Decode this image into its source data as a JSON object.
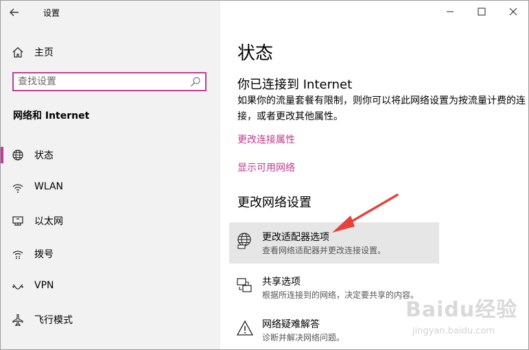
{
  "window": {
    "title": "设置",
    "minimize": "—",
    "maximize": "☐",
    "close": "✕"
  },
  "sidebar": {
    "home_label": "主页",
    "search": {
      "placeholder": "查找设置"
    },
    "section_title": "网络和 Internet",
    "items": [
      {
        "label": "状态",
        "icon": "globe-icon",
        "selected": true
      },
      {
        "label": "WLAN",
        "icon": "wifi-icon",
        "selected": false
      },
      {
        "label": "以太网",
        "icon": "ethernet-icon",
        "selected": false
      },
      {
        "label": "拨号",
        "icon": "dialup-icon",
        "selected": false
      },
      {
        "label": "VPN",
        "icon": "vpn-icon",
        "selected": false
      },
      {
        "label": "飞行模式",
        "icon": "airplane-icon",
        "selected": false
      }
    ]
  },
  "main": {
    "page_title": "状态",
    "status_heading": "你已连接到 Internet",
    "status_desc": "如果你的流量套餐有限制，则你可以将此网络设置为按流量计费的连接，或者更改其他属性。",
    "link_change_props": "更改连接属性",
    "link_show_networks": "显示可用网络",
    "change_heading": "更改网络设置",
    "options": [
      {
        "title": "更改适配器选项",
        "subtitle": "查看网络适配器并更改连接设置。",
        "icon": "adapter-icon"
      },
      {
        "title": "共享选项",
        "subtitle": "根据所连接到的网络，决定要共享的内容。",
        "icon": "sharing-icon"
      },
      {
        "title": "网络疑难解答",
        "subtitle": "诊断并解决网络问题。",
        "icon": "warning-icon"
      }
    ]
  },
  "watermark": {
    "brand": "Baidu经验",
    "url": "jingyan.baidu.com"
  },
  "colors": {
    "accent": "#bf3b9a",
    "link": "#c0378f",
    "sidebar_bg": "#f2f2f2",
    "hover_bg": "#e6e6e6",
    "arrow": "#e8403a"
  }
}
